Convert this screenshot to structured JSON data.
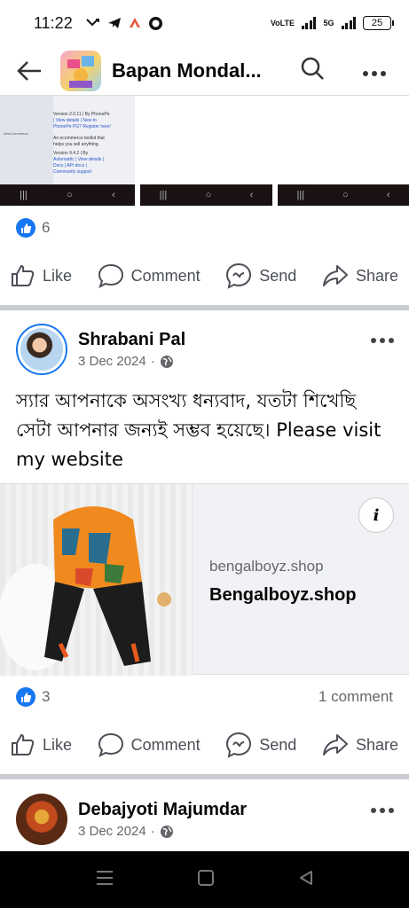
{
  "status_bar": {
    "time": "11:22",
    "network_label": "VoLTE",
    "network_5g": "5G",
    "battery": "25"
  },
  "header": {
    "title": "Bapan Mondal..."
  },
  "post1": {
    "reactions_count": "6"
  },
  "actions": {
    "like": "Like",
    "comment": "Comment",
    "send": "Send",
    "share": "Share"
  },
  "screenshots": {
    "line1": "Version 2.0.11 | By PhonePe",
    "line2": "| View details | New to",
    "line3": "PhonePe PG? Register here!",
    "line4": "An ecommerce toolkit that",
    "line5": "helps you sell anything.",
    "line6": "Version 9.4.2 | By",
    "line7": "Automattic | View details |",
    "line8": "Docs | API docs |",
    "line9": "Community support",
    "side": "WooCommerce"
  },
  "post2": {
    "author": "Shrabani Pal",
    "date": "3 Dec 2024",
    "separator": "·",
    "text": "স্যার আপনাকে অসংখ্য ধন্যবাদ, যতটা শিখেছি সেটা আপনার জন্যই সম্ভব হয়েছে। Please visit my website",
    "link_domain": "bengalboyz.shop",
    "link_title": "Bengalboyz.shop",
    "info_icon": "i",
    "reactions_count": "3",
    "comments": "1 comment"
  },
  "post3": {
    "author": "Debajyoti Majumdar",
    "date": "3 Dec 2024",
    "separator": "·"
  },
  "colors": {
    "accent": "#1877f2",
    "separator": "#c9ccd1"
  }
}
